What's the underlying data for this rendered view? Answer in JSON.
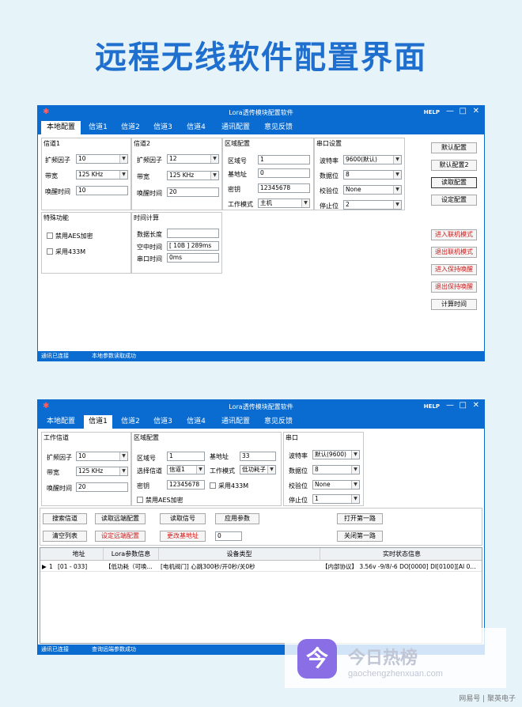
{
  "headline": "远程无线软件配置界面",
  "window_title": "Lora透传模块配置软件",
  "help": "HELP",
  "win_buttons": {
    "min": "—",
    "max": "□",
    "close": "✕"
  },
  "win1": {
    "tabs": [
      "本地配置",
      "信道1",
      "信道2",
      "信道3",
      "信道4",
      "通讯配置",
      "意见反馈"
    ],
    "ch1": {
      "title": "信道1",
      "sf_label": "扩频因子",
      "sf": "10",
      "bw_label": "带宽",
      "bw": "125 KHz",
      "wake_label": "唤醒时间",
      "wake": "10"
    },
    "ch2": {
      "title": "信道2",
      "sf_label": "扩频因子",
      "sf": "12",
      "bw_label": "带宽",
      "bw": "125 KHz",
      "wake_label": "唤醒时间",
      "wake": "20"
    },
    "area": {
      "title": "区域配置",
      "zone_label": "区域号",
      "zone": "1",
      "base_label": "基地址",
      "base": "0",
      "key_label": "密钥",
      "key": "12345678",
      "mode_label": "工作模式",
      "mode": "主机"
    },
    "serial": {
      "title": "串口设置",
      "baud_label": "波特率",
      "baud": "9600(默认)",
      "data_label": "数据位",
      "data": "8",
      "parity_label": "校验位",
      "parity": "None",
      "stop_label": "停止位",
      "stop": "2"
    },
    "special": {
      "title": "特殊功能",
      "aes": "禁用AES加密",
      "f433": "采用433M"
    },
    "timecalc": {
      "title": "时间计算",
      "len_label": "数据长度",
      "len": "",
      "air_label": "空中时间",
      "air": "[ 10B ]   289ms",
      "uart_label": "串口时间",
      "uart": "0ms"
    },
    "buttons": {
      "default": "默认配置",
      "default2": "默认配置2",
      "read": "读取配置",
      "set": "设定配置",
      "enter_online": "进入联机模式",
      "exit_online": "退出联机模式",
      "enter_keep": "进入保持唤醒",
      "exit_keep": "退出保持唤醒",
      "calc": "计算时间"
    },
    "status": {
      "conn": "通讯已连接",
      "msg": "本地参数读取成功"
    }
  },
  "win2": {
    "tabs": [
      "本地配置",
      "信道1",
      "信道2",
      "信道3",
      "信道4",
      "通讯配置",
      "意见反馈"
    ],
    "work": {
      "title": "工作信道",
      "sf_label": "扩频因子",
      "sf": "10",
      "bw_label": "带宽",
      "bw": "125 KHz",
      "wake_label": "唤醒时间",
      "wake": "20"
    },
    "area": {
      "title": "区域配置",
      "zone_label": "区域号",
      "zone": "1",
      "base_label": "基地址",
      "base": "33",
      "sel_label": "选择信道",
      "sel": "信道1",
      "mode_label": "工作模式",
      "mode": "低功耗子",
      "key_label": "密钥",
      "key": "12345678",
      "f433": "采用433M",
      "aes": "禁用AES加密"
    },
    "serial": {
      "title": "串口",
      "baud_label": "波特率",
      "baud": "默认(9600)",
      "data_label": "数据位",
      "data": "8",
      "parity_label": "校验位",
      "parity": "None",
      "stop_label": "停止位",
      "stop": "1"
    },
    "buttons": {
      "search": "搜索信道",
      "read_remote": "读取远端配置",
      "read_signal": "读取信号",
      "apply": "应用参数",
      "open_first": "打开第一路",
      "clear": "清空列表",
      "set_remote": "设定远端配置",
      "change_base": "更改基地址",
      "base_value": "0",
      "close_first": "关闭第一路"
    },
    "grid": {
      "headers": [
        "地址",
        "Lora参数信息",
        "设备类型",
        "实时状态信息"
      ],
      "rows": [
        {
          "index": "1",
          "addr": "[01 - 033]",
          "lora": "【低功耗（可唤...",
          "dev": "[电机阀门] 心跳300秒/开0秒/关0秒",
          "state": "【内部协议】 3.56v -9/8/-6  DO[0000] DI[0100][AI 0..."
        }
      ]
    },
    "status": {
      "conn": "通讯已连接",
      "msg": "查询远端参数成功"
    }
  },
  "watermark": {
    "title": "今日热榜",
    "url": "gaochengzhenxuan.com"
  },
  "credit": "网易号 | 聚英电子"
}
